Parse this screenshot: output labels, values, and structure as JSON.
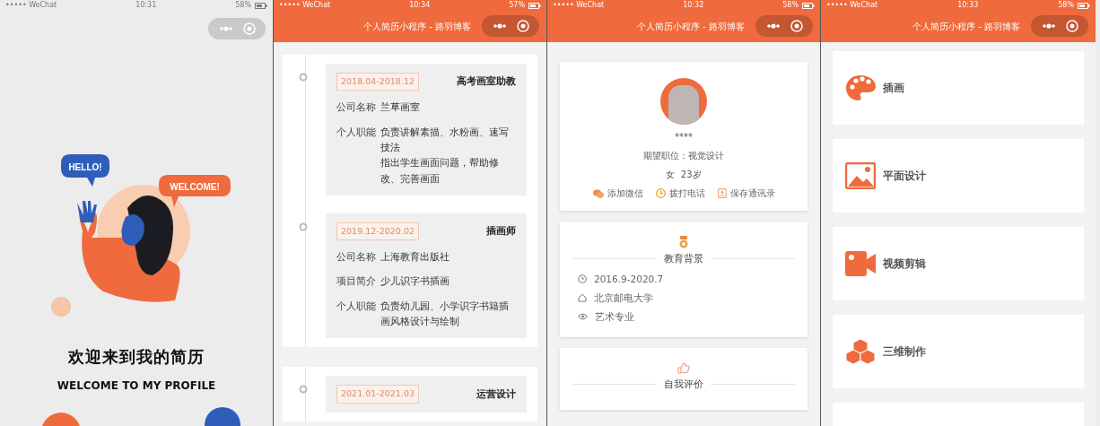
{
  "screens": [
    {
      "kind": "welcome",
      "status_bar": {
        "carrier": "••••• WeChat",
        "time": "10:31",
        "battery": "58%"
      },
      "bubbles": [
        "HELLO!",
        "WELCOME!"
      ],
      "title": "欢迎来到我的简历",
      "subtitle": "WELCOME TO MY PROFILE"
    },
    {
      "kind": "timeline",
      "status_bar": {
        "carrier": "••••• WeChat",
        "time": "10:34",
        "battery": "57%"
      },
      "nav_title": "个人简历小程序 - 路羽博客",
      "cards": [
        {
          "entries": [
            {
              "date": "2018.04-2018.12",
              "role": "高考画室助教",
              "fields": [
                {
                  "label": "公司名称",
                  "lines": [
                    "兰草画室"
                  ]
                },
                {
                  "label": "个人职能",
                  "lines": [
                    "负责讲解素描、水粉画、速写技法",
                    "指出学生画面问题，帮助修改、完善画面"
                  ]
                }
              ]
            },
            {
              "date": "2019.12-2020.02",
              "role": "插画师",
              "fields": [
                {
                  "label": "公司名称",
                  "lines": [
                    "上海教育出版社"
                  ]
                },
                {
                  "label": "项目简介",
                  "lines": [
                    "少儿识字书插画"
                  ]
                },
                {
                  "label": "个人职能",
                  "lines": [
                    "负责幼儿园、小学识字书籍插画风格设计与绘制"
                  ]
                }
              ]
            }
          ]
        },
        {
          "entries": [
            {
              "date": "2021.01-2021.03",
              "role": "运营设计"
            }
          ]
        }
      ]
    },
    {
      "kind": "profile",
      "status_bar": {
        "carrier": "••••• WeChat",
        "time": "10:32",
        "battery": "58%"
      },
      "nav_title": "个人简历小程序 - 路羽博客",
      "name": "****",
      "position": "期望职位：视觉设计",
      "info": "女  23岁",
      "actions": [
        {
          "kind": "wechat",
          "label": "添加微信"
        },
        {
          "kind": "phone",
          "label": "拨打电话"
        },
        {
          "kind": "contacts",
          "label": "保存通讯录"
        }
      ],
      "sections": [
        {
          "kind": "medal",
          "heading": "教育背景",
          "items": [
            {
              "kind": "clock",
              "text": "2016.9-2020.7"
            },
            {
              "kind": "home",
              "text": "北京邮电大学"
            },
            {
              "kind": "eye",
              "text": "艺术专业"
            }
          ]
        },
        {
          "kind": "thumb",
          "heading": "自我评价"
        }
      ]
    },
    {
      "kind": "skills",
      "status_bar": {
        "carrier": "••••• WeChat",
        "time": "10:33",
        "battery": "58%"
      },
      "nav_title": "个人简历小程序 - 路羽博客",
      "items": [
        {
          "kind": "palette",
          "label": "插画"
        },
        {
          "kind": "image",
          "label": "平面设计"
        },
        {
          "kind": "video",
          "label": "视频剪辑"
        },
        {
          "kind": "cubes",
          "label": "三维制作"
        },
        {
          "kind": "blank"
        }
      ]
    }
  ]
}
